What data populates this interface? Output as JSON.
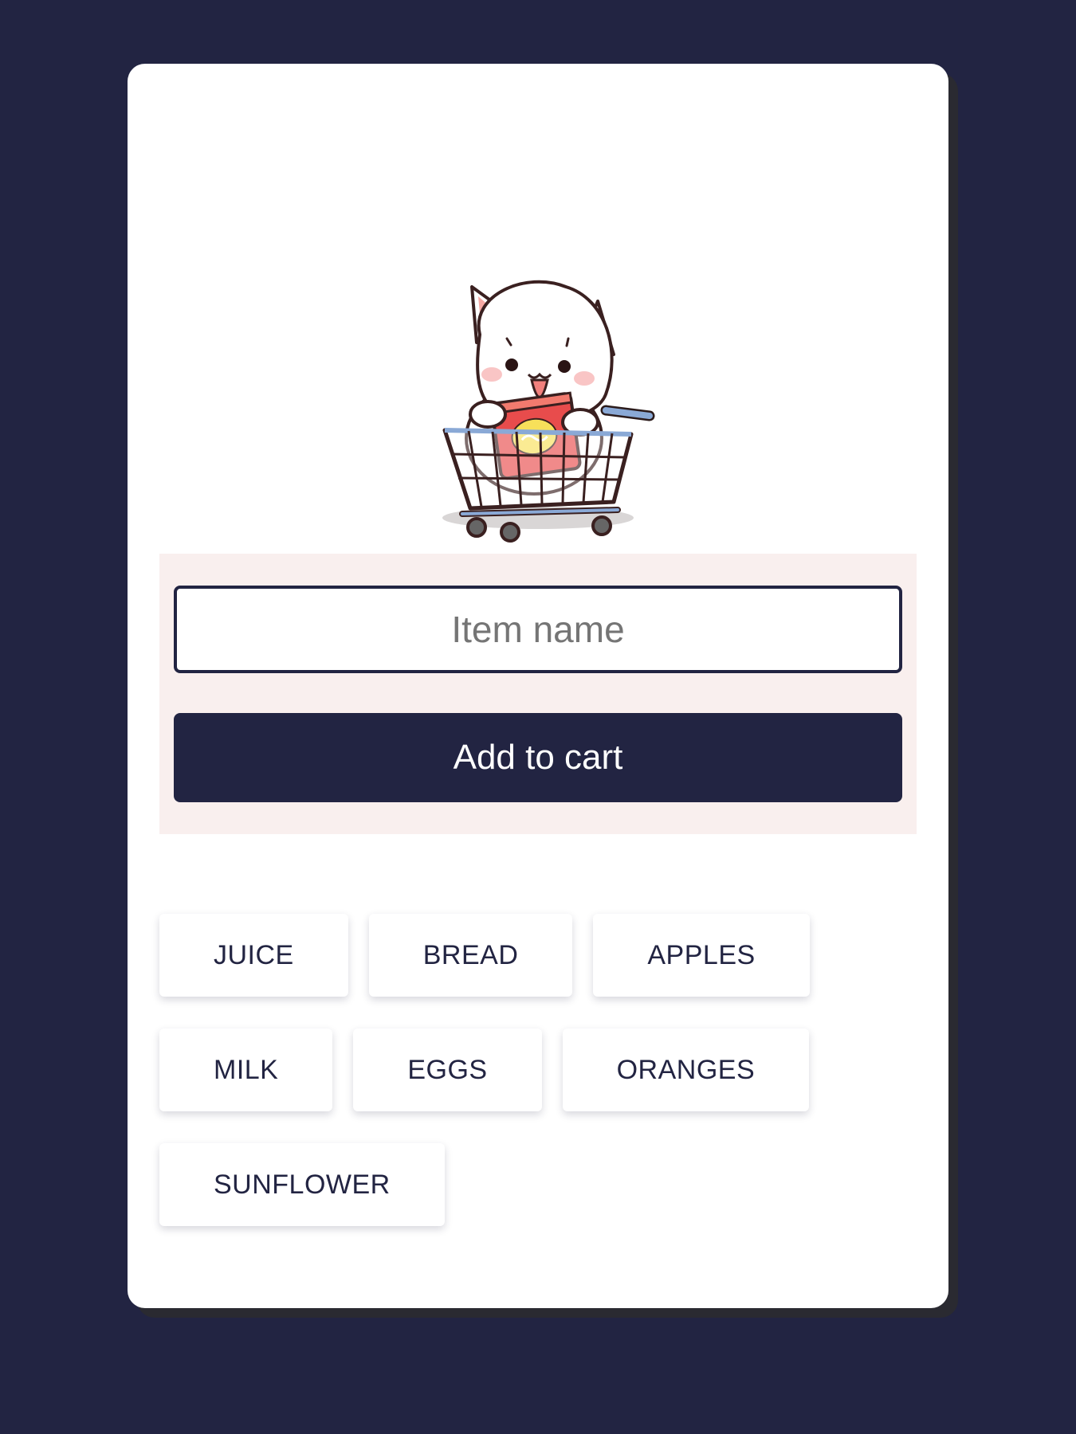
{
  "form": {
    "input_placeholder": "Item name",
    "input_value": "",
    "add_button_label": "Add to cart"
  },
  "hero": {
    "icon": "cat-in-shopping-cart-illustration"
  },
  "items": [
    {
      "label": "JUICE"
    },
    {
      "label": "BREAD"
    },
    {
      "label": "APPLES"
    },
    {
      "label": "MILK"
    },
    {
      "label": "EGGS"
    },
    {
      "label": "ORANGES"
    },
    {
      "label": "SUNFLOWER"
    }
  ],
  "colors": {
    "background": "#222442",
    "card": "#ffffff",
    "accent": "#222442",
    "panel": "#f9efee",
    "cart": "#8aa9d6",
    "snack_bag": "#e84c4c"
  }
}
